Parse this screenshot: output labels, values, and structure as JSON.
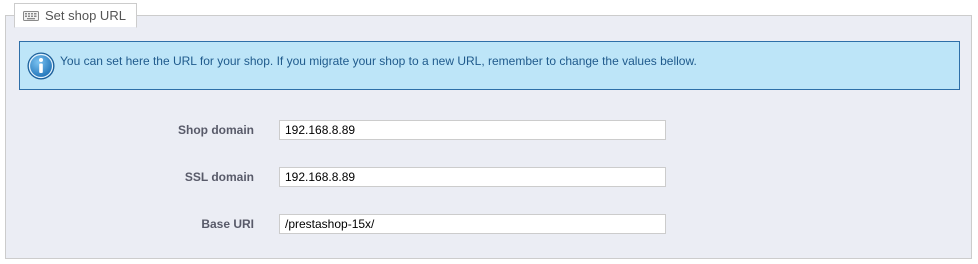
{
  "fieldset": {
    "legend": "Set shop URL",
    "legend_icon": "keyboard-icon"
  },
  "info": {
    "icon": "info-icon",
    "text": "You can set here the URL for your shop. If you migrate your shop to a new URL, remember to change the values bellow."
  },
  "form": {
    "shop_domain": {
      "label": "Shop domain",
      "value": "192.168.8.89"
    },
    "ssl_domain": {
      "label": "SSL domain",
      "value": "192.168.8.89"
    },
    "base_uri": {
      "label": "Base URI",
      "value": "/prestashop-15x/"
    }
  },
  "colors": {
    "fieldset_bg": "#ebedf4",
    "info_bg": "#bde5f8",
    "info_border": "#2e6fa8",
    "info_text": "#1f5a8c"
  }
}
